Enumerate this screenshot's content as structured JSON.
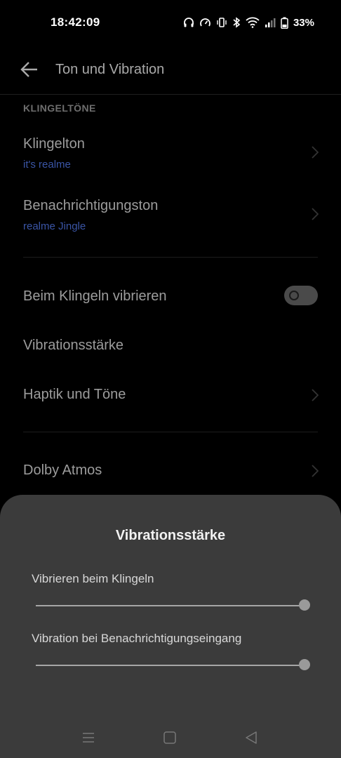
{
  "status_bar": {
    "time": "18:42:09",
    "battery_percent": "33%",
    "icons": [
      "headphones-icon",
      "speedometer-icon",
      "vibrate-icon",
      "bluetooth-icon",
      "wifi-icon",
      "signal-icon",
      "battery-icon"
    ]
  },
  "header": {
    "title": "Ton und Vibration",
    "back_icon": "arrow-left-icon"
  },
  "section": {
    "title": "KLINGELTÖNE"
  },
  "settings": {
    "ringtone": {
      "label": "Klingelton",
      "value": "it's realme"
    },
    "notification_tone": {
      "label": "Benachrichtigungston",
      "value": "realme Jingle"
    },
    "vibrate_on_ring": {
      "label": "Beim Klingeln vibrieren",
      "enabled": false
    },
    "vibration_intensity": {
      "label": "Vibrationsstärke"
    },
    "haptics": {
      "label": "Haptik und Töne"
    },
    "dolby": {
      "label": "Dolby Atmos"
    }
  },
  "sheet": {
    "title": "Vibrationsstärke",
    "sliders": [
      {
        "label": "Vibrieren beim Klingeln",
        "value": 1.0
      },
      {
        "label": "Vibration bei Benachrichtigungseingang",
        "value": 1.0
      }
    ]
  },
  "nav_bar": {
    "buttons": [
      "menu-icon",
      "home-icon",
      "back-triangle-icon"
    ]
  },
  "colors": {
    "accent_sub": "#3a55a6",
    "sheet_bg": "#3b3b3b",
    "toggle_off": "#4a4a4a"
  }
}
